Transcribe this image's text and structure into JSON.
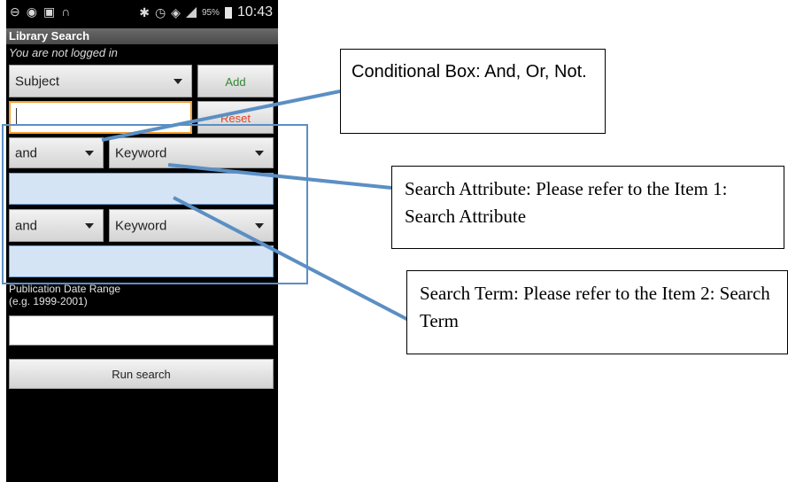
{
  "status_bar": {
    "left_icons": [
      "minus-circle-icon",
      "android-icon",
      "image-icon",
      "headphones-icon"
    ],
    "right_icons": [
      "bluetooth-icon",
      "alarm-icon",
      "wifi-icon",
      "signal-icon"
    ],
    "battery_percent": "95%",
    "time": "10:43"
  },
  "app": {
    "title": "Library Search",
    "login_status": "You are not logged in",
    "field_select": {
      "value": "Subject"
    },
    "add_label": "Add",
    "reset_label": "Reset",
    "rows": [
      {
        "operator": "and",
        "attribute": "Keyword"
      },
      {
        "operator": "and",
        "attribute": "Keyword"
      }
    ],
    "pubdate_label": "Publication Date Range",
    "pubdate_hint": "(e.g. 1999-2001)",
    "run_label": "Run search"
  },
  "callouts": {
    "conditional": "Conditional Box: And, Or, Not.",
    "attribute": "Search Attribute: Please refer to the Item 1: Search Attribute",
    "term": "Search Term: Please refer to the Item 2: Search Term"
  },
  "colors": {
    "add_text": "#2e8b2e",
    "reset_text": "#e0442a",
    "focus_border": "#f3a033",
    "highlight_fill": "#d5e4f5",
    "annotation_line": "#5b8fc4"
  }
}
